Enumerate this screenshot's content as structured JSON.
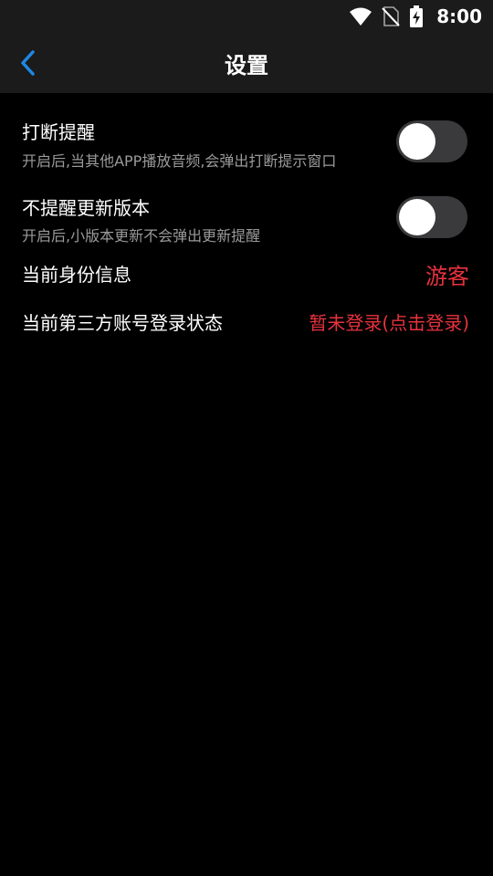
{
  "status_bar": {
    "time": "8:00",
    "icons": [
      "wifi-icon",
      "no-sim-icon",
      "battery-charging-icon"
    ]
  },
  "app_bar": {
    "back_icon": "chevron-left-icon",
    "title": "设置"
  },
  "settings": {
    "interrupt_reminder": {
      "title": "打断提醒",
      "subtitle": "开启后,当其他APP播放音频,会弹出打断提示窗口",
      "enabled": false
    },
    "update_reminder": {
      "title": "不提醒更新版本",
      "subtitle": "开启后,小版本更新不会弹出更新提醒",
      "enabled": false
    },
    "identity": {
      "label": "当前身份信息",
      "value": "游客"
    },
    "third_party_login": {
      "label": "当前第三方账号登录状态",
      "value": "暂未登录(点击登录)"
    }
  },
  "colors": {
    "background": "#000000",
    "bar": "#1b1b1b",
    "accent_blue": "#1e88e5",
    "value_red": "#e8323d",
    "subtitle_gray": "#9a9a9a",
    "toggle_track_off": "#3a3a3c"
  }
}
